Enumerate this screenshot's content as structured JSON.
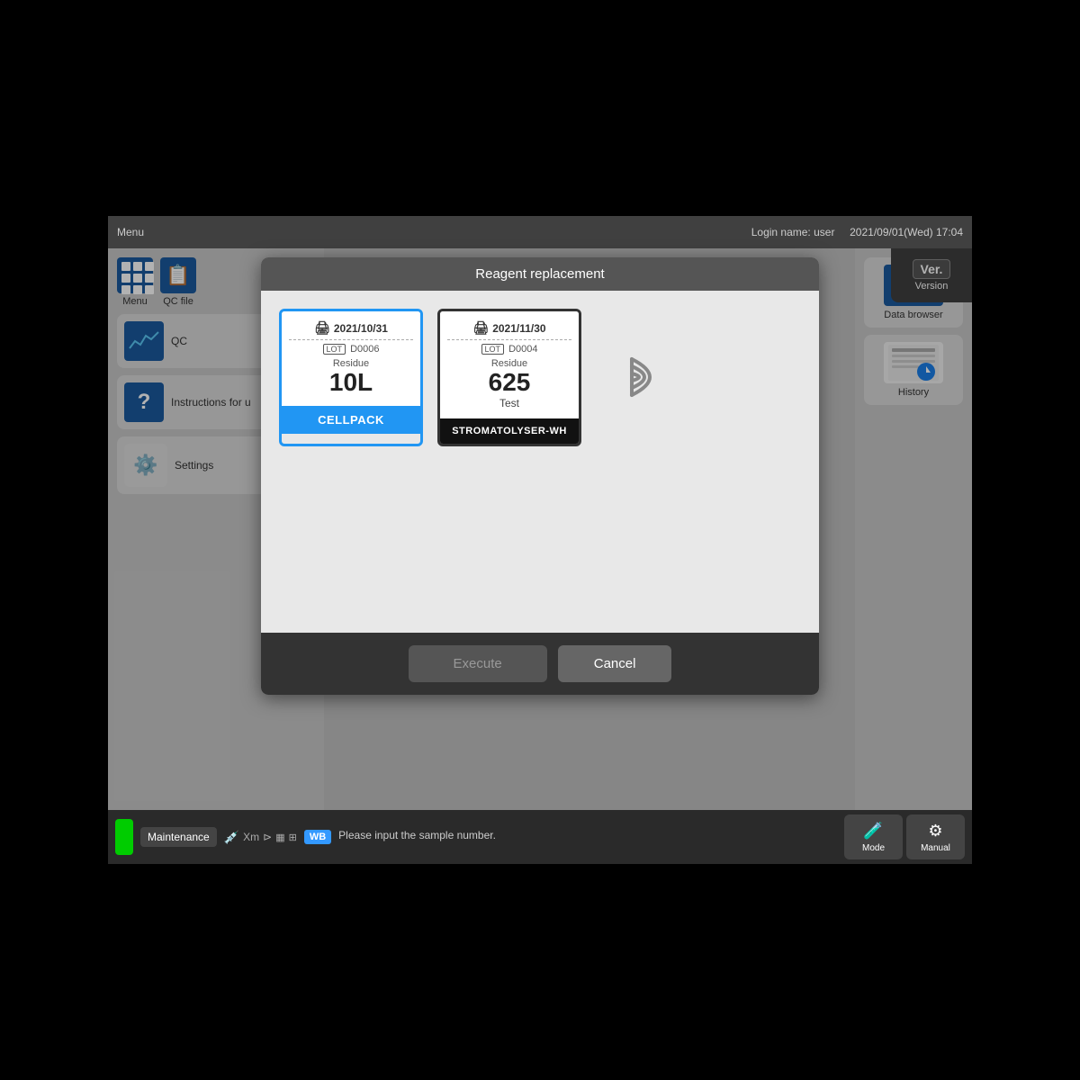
{
  "topBar": {
    "menuLabel": "Menu",
    "loginLabel": "Login name: user",
    "dateTime": "2021/09/01(Wed) 17:04"
  },
  "version": {
    "badge": "Ver.",
    "label": "Version"
  },
  "sidebar": {
    "items": [
      {
        "id": "menu",
        "label": "Menu"
      },
      {
        "id": "qcfile",
        "label": "QC file"
      },
      {
        "id": "qc",
        "label": "QC"
      },
      {
        "id": "instructions",
        "label": "Instructions for u"
      },
      {
        "id": "settings",
        "label": "Settings"
      }
    ]
  },
  "rightSidebar": {
    "items": [
      {
        "id": "data-browser",
        "label": "Data browser"
      },
      {
        "id": "history",
        "label": "History"
      }
    ]
  },
  "modal": {
    "title": "Reagent replacement",
    "card1": {
      "date": "2021/10/31",
      "lotBadge": "LOT",
      "lot": "D0006",
      "residueLabel": "Residue",
      "residueValue": "10L",
      "name": "CELLPACK",
      "selected": true
    },
    "card2": {
      "date": "2021/11/30",
      "lotBadge": "LOT",
      "lot": "D0004",
      "residueLabel": "Residue",
      "residueValue": "625",
      "residueUnit": "Test",
      "name": "STROMATOLYSER-WH",
      "selected": false
    },
    "executeLabel": "Execute",
    "cancelLabel": "Cancel"
  },
  "statusBar": {
    "maintenanceLabel": "Maintenance",
    "wbBadge": "WB",
    "message": "Please input the sample number.",
    "modeLabel": "Mode",
    "manualLabel": "Manual"
  }
}
